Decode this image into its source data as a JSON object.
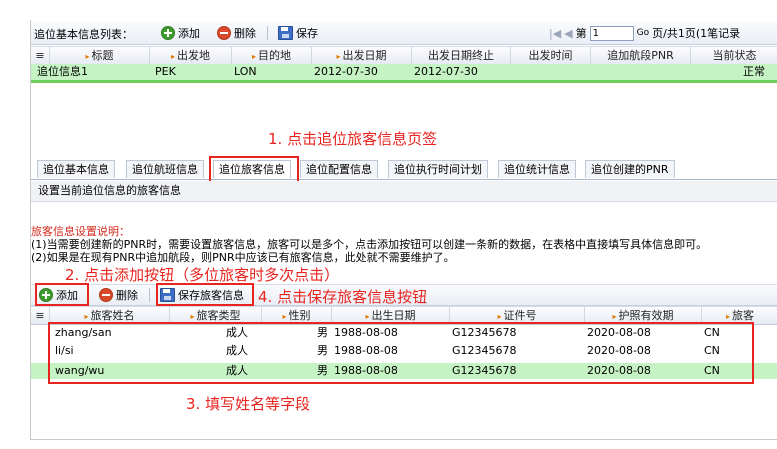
{
  "top_toolbar": {
    "title": "追位基本信息列表：",
    "add_label": "添加",
    "delete_label": "删除",
    "save_label": "保存",
    "page_prefix": "第",
    "page_value": "1",
    "go_label": "Go",
    "page_suffix": "页/共1页(1笔记录"
  },
  "top_grid": {
    "columns": [
      "标题",
      "出发地",
      "目的地",
      "出发日期",
      "出发日期终止",
      "出发时间",
      "追加航段PNR",
      "当前状态"
    ],
    "rows": [
      {
        "title": "追位信息1",
        "origin": "PEK",
        "dest": "LON",
        "date": "2012-07-30",
        "date_end": "2012-07-30",
        "time": "",
        "pnr": "",
        "status": "正常"
      }
    ]
  },
  "annotations": {
    "a1": "1. 点击追位旅客信息页签",
    "a2": "2. 点击添加按钮（多位旅客时多次点击）",
    "a3": "3. 填写姓名等字段",
    "a4": "4. 点击保存旅客信息按钮"
  },
  "tabs": [
    "追位基本信息",
    "追位航班信息",
    "追位旅客信息",
    "追位配置信息",
    "追位执行时间计划",
    "追位统计信息",
    "追位创建的PNR"
  ],
  "active_tab": "追位旅客信息",
  "section_title": "设置当前追位信息的旅客信息",
  "notes": {
    "heading": "旅客信息设置说明：",
    "line1": "(1)当需要创建新的PNR时，需要设置旅客信息，旅客可以是多个，点击添加按钮可以创建一条新的数据，在表格中直接填写具体信息即可。",
    "line2": "(2)如果是在现有PNR中追加航段，则PNR中应该已有旅客信息，此处就不需要维护了。"
  },
  "passenger_toolbar": {
    "add_label": "添加",
    "delete_label": "删除",
    "save_label": "保存旅客信息"
  },
  "passenger_grid": {
    "columns": [
      "旅客姓名",
      "旅客类型",
      "性别",
      "出生日期",
      "证件号",
      "护照有效期",
      "旅客"
    ],
    "rows": [
      {
        "name": "zhang/san",
        "type": "成人",
        "sex": "男",
        "birth": "1988-08-08",
        "id": "G12345678",
        "expiry": "2020-08-08",
        "nat": "CN"
      },
      {
        "name": "li/si",
        "type": "成人",
        "sex": "男",
        "birth": "1988-08-08",
        "id": "G12345678",
        "expiry": "2020-08-08",
        "nat": "CN"
      },
      {
        "name": "wang/wu",
        "type": "成人",
        "sex": "男",
        "birth": "1988-08-08",
        "id": "G12345678",
        "expiry": "2020-08-08",
        "nat": "CN"
      }
    ]
  },
  "colors": {
    "annotation_red": "#e8241f",
    "selected_row": "#c6f3c4",
    "header_bg": "#e9eef6"
  }
}
